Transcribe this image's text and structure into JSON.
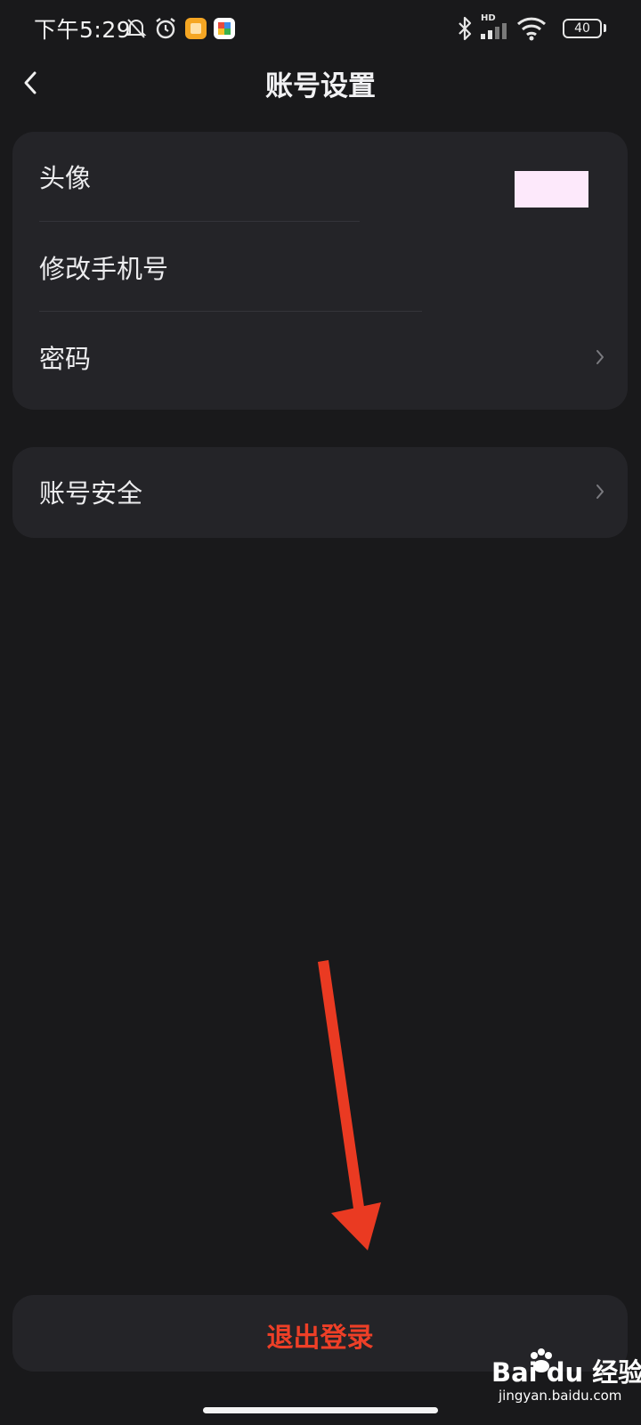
{
  "status_bar": {
    "time": "下午5:29",
    "battery_level": "40",
    "network_badge": "HD",
    "icons": [
      "mute-bell-icon",
      "alarm-icon",
      "gallery-app-icon",
      "puzzle-app-icon",
      "bluetooth-icon",
      "signal-icon",
      "wifi-icon",
      "battery-icon"
    ]
  },
  "header": {
    "title": "账号设置",
    "back_icon": "back-chevron-icon"
  },
  "settings_group_1": {
    "items": [
      {
        "label": "头像",
        "trailing": "avatar-thumbnail"
      },
      {
        "label": "修改手机号"
      },
      {
        "label": "密码",
        "trailing": "chevron-right-icon"
      }
    ]
  },
  "settings_group_2": {
    "items": [
      {
        "label": "账号安全",
        "trailing": "chevron-right-icon"
      }
    ]
  },
  "logout": {
    "label": "退出登录",
    "color": "#ee3f27"
  },
  "annotation": {
    "arrow_color": "#ea3a22"
  },
  "watermark": {
    "main": "Bai du 经验",
    "sub": "jingyan.baidu.com"
  },
  "colors": {
    "background": "#19191b",
    "card": "#242428",
    "avatar_fill": "#fde9fb"
  }
}
